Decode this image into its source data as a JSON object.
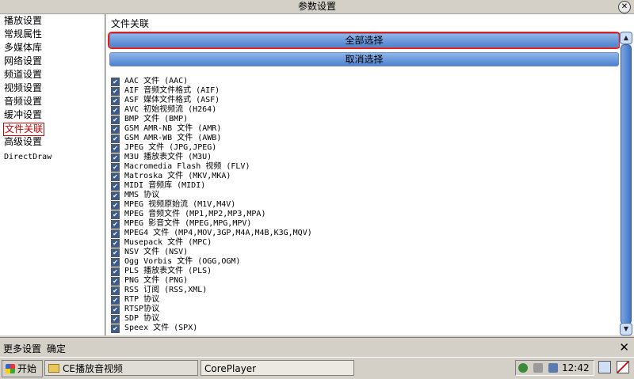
{
  "window": {
    "title": "参数设置",
    "close_glyph": "✕"
  },
  "sidebar": {
    "items": [
      {
        "label": "播放设置",
        "active": false
      },
      {
        "label": "常规属性",
        "active": false
      },
      {
        "label": "多媒体库",
        "active": false
      },
      {
        "label": "网络设置",
        "active": false
      },
      {
        "label": "频道设置",
        "active": false
      },
      {
        "label": "视频设置",
        "active": false
      },
      {
        "label": "音频设置",
        "active": false
      },
      {
        "label": "缓冲设置",
        "active": false
      },
      {
        "label": "文件关联",
        "active": true
      },
      {
        "label": "高级设置",
        "active": false
      },
      {
        "label": "DirectDraw",
        "active": false
      }
    ]
  },
  "main": {
    "section_title": "文件关联",
    "select_all_label": "全部选择",
    "deselect_label": "取消选择",
    "checked_glyph": "✔",
    "file_types": [
      "AAC 文件 (AAC)",
      "AIF 音频文件格式 (AIF)",
      "ASF 媒体文件格式 (ASF)",
      "AVC 初始视频流 (H264)",
      "BMP 文件 (BMP)",
      "GSM AMR-NB 文件 (AMR)",
      "GSM AMR-WB 文件 (AWB)",
      "JPEG 文件 (JPG,JPEG)",
      "M3U 播放表文件 (M3U)",
      "Macromedia Flash 视频 (FLV)",
      "Matroska 文件 (MKV,MKA)",
      "MIDI 音频库 (MIDI)",
      "MMS 协议",
      "MPEG 视频原始流 (M1V,M4V)",
      "MPEG 音频文件 (MP1,MP2,MP3,MPA)",
      "MPEG 影音文件 (MPEG,MPG,MPV)",
      "MPEG4 文件 (MP4,MOV,3GP,M4A,M4B,K3G,MQV)",
      "Musepack 文件 (MPC)",
      "NSV 文件 (NSV)",
      "Ogg Vorbis 文件 (OGG,OGM)",
      "PLS 播放表文件 (PLS)",
      "PNG 文件 (PNG)",
      "RSS 订阅 (RSS,XML)",
      "RTP 协议",
      "RTSP协议",
      "SDP 协议",
      "Speex 文件 (SPX)"
    ]
  },
  "scrollbar": {
    "up_glyph": "▲",
    "down_glyph": "▼"
  },
  "bottom_bar": {
    "more_settings_label": "更多设置",
    "ok_label": "确定",
    "close_glyph": "✕"
  },
  "taskbar": {
    "start_label": "开始",
    "tasks": [
      "CE播放音视频",
      "CorePlayer"
    ],
    "clock": "12:42"
  },
  "colors": {
    "accent": "#4e82cf",
    "highlight": "#e02020",
    "active_text": "#c00000"
  }
}
